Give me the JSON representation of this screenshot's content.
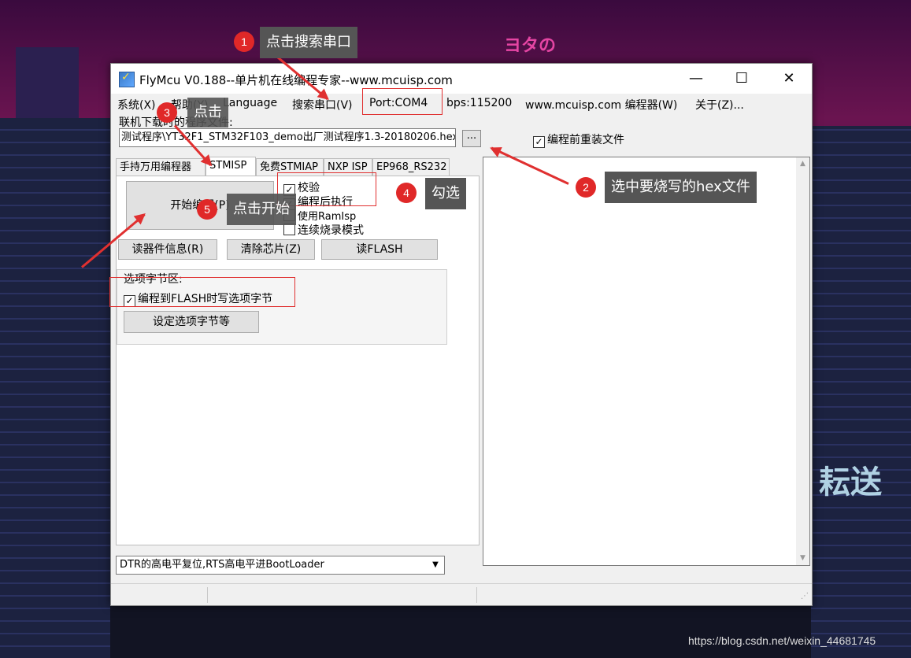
{
  "window": {
    "title": "FlyMcu V0.188--单片机在线编程专家--www.mcuisp.com",
    "minimize": "—",
    "maximize": "☐",
    "close": "✕"
  },
  "menu": [
    "系统(X)",
    "帮助(Y)",
    "Language",
    "搜索串口(V)",
    "Port:COM4",
    "bps:115200",
    "www.mcuisp.com 编程器(W)",
    "关于(Z)..."
  ],
  "file": {
    "label": "联机下载时的程序文件:",
    "path": "测试程序\\YT32F1_STM32F103_demo出厂测试程序1.3-20180206.hex",
    "browse": "...",
    "reload_checked": true,
    "reload_label": "编程前重装文件"
  },
  "tabs": [
    "手持万用编程器",
    "STMISP",
    "免费STMIAP",
    "NXP ISP",
    "EP968_RS232"
  ],
  "isp": {
    "start_button": "开始编程(P)",
    "verify_label": "校验",
    "verify_checked": true,
    "run_label": "编程后执行",
    "run_checked": true,
    "ramisp_label": "使用RamIsp",
    "ramisp_checked": false,
    "continuous_label": "连续烧录模式",
    "continuous_checked": false,
    "read_info_button": "读器件信息(R)",
    "erase_button": "清除芯片(Z)",
    "read_flash_button": "读FLASH",
    "option_group_label": "选项字节区:",
    "option_write_label": "编程到FLASH时写选项字节",
    "option_write_checked": true,
    "option_set_button": "设定选项字节等"
  },
  "reset_mode": "DTR的高电平复位,RTS高电平进BootLoader",
  "annotations": {
    "step1": {
      "num": "1",
      "text": "点击搜索串口"
    },
    "step2": {
      "num": "2",
      "text": "选中要烧写的hex文件"
    },
    "step3": {
      "num": "3",
      "text": "点击"
    },
    "step4": {
      "num": "4",
      "text": "勾选"
    },
    "step5": {
      "num": "5",
      "text": "点击开始"
    }
  },
  "watermark": "https://blog.csdn.net/weixin_44681745",
  "colors": {
    "annotation_red": "#e03030",
    "tooltip_gray": "#555555"
  }
}
